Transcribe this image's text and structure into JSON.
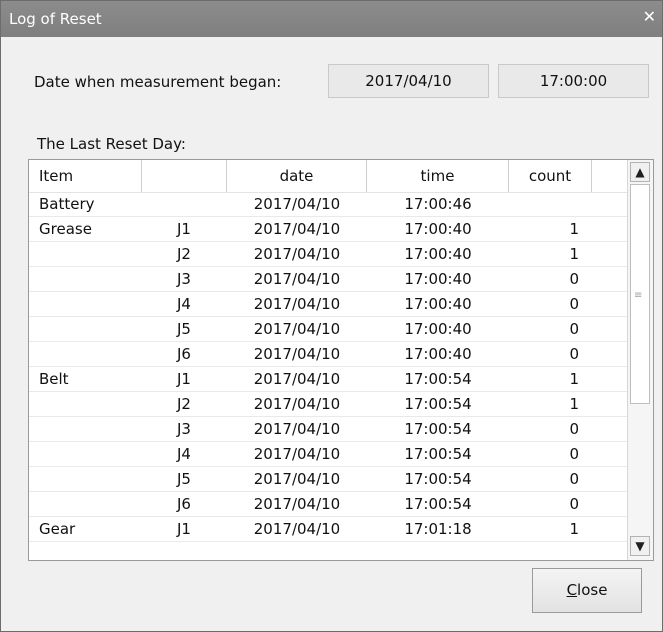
{
  "window": {
    "title": "Log of Reset",
    "close_glyph": "✕"
  },
  "measurement": {
    "label": "Date when measurement began:",
    "date": "2017/04/10",
    "time": "17:00:00"
  },
  "reset_section": {
    "label": "The Last Reset Day:"
  },
  "table": {
    "headers": [
      "Item",
      "",
      "date",
      "time",
      "count"
    ],
    "rows": [
      {
        "item": "Battery",
        "joint": "",
        "date": "2017/04/10",
        "time": "17:00:46",
        "count": ""
      },
      {
        "item": "Grease",
        "joint": "J1",
        "date": "2017/04/10",
        "time": "17:00:40",
        "count": "1"
      },
      {
        "item": "",
        "joint": "J2",
        "date": "2017/04/10",
        "time": "17:00:40",
        "count": "1"
      },
      {
        "item": "",
        "joint": "J3",
        "date": "2017/04/10",
        "time": "17:00:40",
        "count": "0"
      },
      {
        "item": "",
        "joint": "J4",
        "date": "2017/04/10",
        "time": "17:00:40",
        "count": "0"
      },
      {
        "item": "",
        "joint": "J5",
        "date": "2017/04/10",
        "time": "17:00:40",
        "count": "0"
      },
      {
        "item": "",
        "joint": "J6",
        "date": "2017/04/10",
        "time": "17:00:40",
        "count": "0"
      },
      {
        "item": "Belt",
        "joint": "J1",
        "date": "2017/04/10",
        "time": "17:00:54",
        "count": "1"
      },
      {
        "item": "",
        "joint": "J2",
        "date": "2017/04/10",
        "time": "17:00:54",
        "count": "1"
      },
      {
        "item": "",
        "joint": "J3",
        "date": "2017/04/10",
        "time": "17:00:54",
        "count": "0"
      },
      {
        "item": "",
        "joint": "J4",
        "date": "2017/04/10",
        "time": "17:00:54",
        "count": "0"
      },
      {
        "item": "",
        "joint": "J5",
        "date": "2017/04/10",
        "time": "17:00:54",
        "count": "0"
      },
      {
        "item": "",
        "joint": "J6",
        "date": "2017/04/10",
        "time": "17:00:54",
        "count": "0"
      },
      {
        "item": "Gear",
        "joint": "J1",
        "date": "2017/04/10",
        "time": "17:01:18",
        "count": "1"
      }
    ]
  },
  "scrollbar": {
    "up_glyph": "▲",
    "down_glyph": "▼",
    "grip_glyph": "≡"
  },
  "buttons": {
    "close_accel": "C",
    "close_rest": "lose"
  },
  "icons": {
    "title_close": "close-icon",
    "scroll_up": "arrow-up-icon",
    "scroll_down": "arrow-down-icon"
  }
}
